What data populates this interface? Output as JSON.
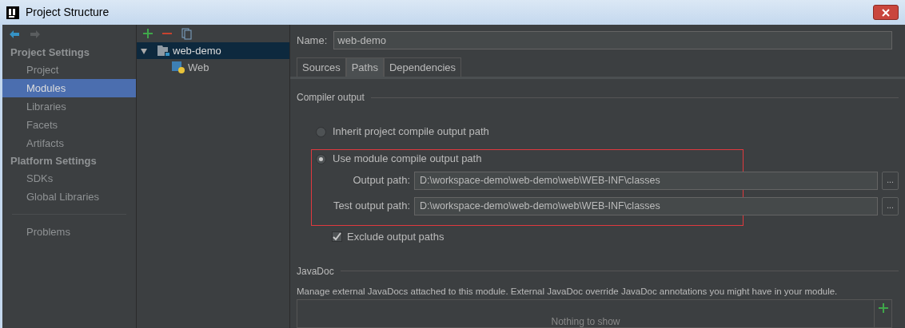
{
  "window": {
    "title": "Project Structure"
  },
  "sidebar": {
    "sections": [
      {
        "heading": "Project Settings",
        "items": [
          {
            "label": "Project",
            "selected": false
          },
          {
            "label": "Modules",
            "selected": true
          },
          {
            "label": "Libraries",
            "selected": false
          },
          {
            "label": "Facets",
            "selected": false
          },
          {
            "label": "Artifacts",
            "selected": false
          }
        ]
      },
      {
        "heading": "Platform Settings",
        "items": [
          {
            "label": "SDKs",
            "selected": false
          },
          {
            "label": "Global Libraries",
            "selected": false
          }
        ]
      }
    ],
    "footer_items": [
      {
        "label": "Problems",
        "selected": false
      }
    ]
  },
  "tree": [
    {
      "label": "web-demo",
      "selected": true,
      "expanded": true,
      "children": [
        {
          "label": "Web",
          "selected": false
        }
      ]
    }
  ],
  "name_field": {
    "label": "Name:",
    "value": "web-demo"
  },
  "tabs": [
    {
      "label": "Sources",
      "selected": false
    },
    {
      "label": "Paths",
      "selected": true
    },
    {
      "label": "Dependencies",
      "selected": false
    }
  ],
  "compiler_output": {
    "heading": "Compiler output",
    "radios": [
      {
        "label": "Inherit project compile output path",
        "selected": false
      },
      {
        "label": "Use module compile output path",
        "selected": true
      }
    ],
    "paths": [
      {
        "label": "Output path:",
        "value": "D:\\workspace-demo\\web-demo\\web\\WEB-INF\\classes",
        "browse": "..."
      },
      {
        "label": "Test output path:",
        "value": "D:\\workspace-demo\\web-demo\\web\\WEB-INF\\classes",
        "browse": "..."
      }
    ],
    "exclude": {
      "label": "Exclude output paths",
      "checked": true
    }
  },
  "javadoc": {
    "heading": "JavaDoc",
    "description": "Manage external JavaDocs attached to this module. External JavaDoc override JavaDoc annotations you might have in your module.",
    "empty_text": "Nothing to show"
  }
}
